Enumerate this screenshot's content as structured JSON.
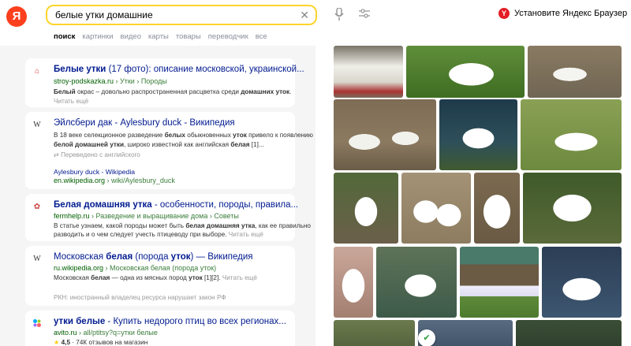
{
  "header": {
    "logo": "Я",
    "query": "белые утки домашние",
    "browser_promo": "Установите Яндекс Браузер",
    "browser_logo": "Y"
  },
  "tabs": [
    {
      "label": "поиск",
      "active": true
    },
    {
      "label": "картинки"
    },
    {
      "label": "видео"
    },
    {
      "label": "карты"
    },
    {
      "label": "товары"
    },
    {
      "label": "переводчик"
    },
    {
      "label": "все"
    }
  ],
  "results": [
    {
      "title_a": "Белые утки",
      "title_b": " (17 фото): описание московской, украинской...",
      "url_a": "stroy-podskazka.ru",
      "url_b": " › Утки › Породы",
      "snippet_a": "Белый",
      "snippet_b": " окрас – довольно распространенная расцветка среди ",
      "snippet_c": "домашних уток",
      "snippet_d": ".",
      "more": "Читать ещё"
    },
    {
      "title": "Эйлсбери дак - Aylesbury duck - Википедия",
      "snippet1_a": "В 18 веке селекционное разведение ",
      "snippet1_b": "белых",
      "snippet1_c": " обыкновенных ",
      "snippet1_d": "уток",
      "snippet1_e": " привело к появлению",
      "snippet2_a": "белой домашней утки",
      "snippet2_b": ", широко известной как английская ",
      "snippet2_c": "белая",
      "snippet2_d": " [1]...",
      "translated": "Переведено с английского",
      "sub_title": "Aylesbury duck - Wikipedia",
      "sub_url_a": "en.wikipedia.org",
      "sub_url_b": " › wiki/Aylesbury_duck"
    },
    {
      "title_a": "Белая домашняя утка",
      "title_b": " - особенности, породы, правила...",
      "url_a": "fermhelp.ru",
      "url_b": " › Разведение и выращивание дома › Советы",
      "snippet1_a": "В статье узнаем, какой породы может быть ",
      "snippet1_b": "белая домашняя утка",
      "snippet1_c": ", как ее правильно",
      "snippet2": "разводить и о чем следует учесть птицеводу при выборе.",
      "more": "Читать ещё"
    },
    {
      "title_a": "Московская ",
      "title_b": "белая",
      "title_c": " (порода ",
      "title_d": "уток",
      "title_e": ") — Википедия",
      "url_a": "ru.wikipedia.org",
      "url_b": " › Московская белая (порода уток)",
      "snippet_a": "Московская ",
      "snippet_b": "белая",
      "snippet_c": " — одна из мясных пород ",
      "snippet_d": "уток",
      "snippet_e": " [1][2].",
      "more": "Читать ещё",
      "notice": "РКН: иностранный владелец ресурса нарушает закон РФ"
    },
    {
      "title_a": "утки белые",
      "title_b": " - Купить недорого птиц во всех регионах...",
      "url_a": "avito.ru",
      "url_b": " › all/ptitsy?q=утки белые",
      "rating": "4,5",
      "reviews": " · 74К отзывов на магазин"
    }
  ],
  "colors": {
    "accent": "#fed42b",
    "logo_red": "#fc3f1d",
    "title_blue": "#001a8f",
    "url_green": "#006000"
  },
  "images": [
    {
      "name": "image-ducks-flock"
    },
    {
      "name": "image-duck-grass"
    },
    {
      "name": "image-ducks-group"
    },
    {
      "name": "image-ducks-resting"
    },
    {
      "name": "image-duck-pond-edge"
    },
    {
      "name": "image-duck-lying-grass"
    },
    {
      "name": "image-duck-standing-path"
    },
    {
      "name": "image-ducks-pair"
    },
    {
      "name": "image-duck-sitting"
    },
    {
      "name": "image-duck-walking"
    },
    {
      "name": "image-duck-closeup"
    },
    {
      "name": "image-duck-swimming"
    },
    {
      "name": "image-ducks-yard"
    },
    {
      "name": "image-duck-water"
    },
    {
      "name": "image-duck-bottom-1"
    },
    {
      "name": "image-duck-bottom-2"
    },
    {
      "name": "image-duck-bottom-3"
    }
  ]
}
